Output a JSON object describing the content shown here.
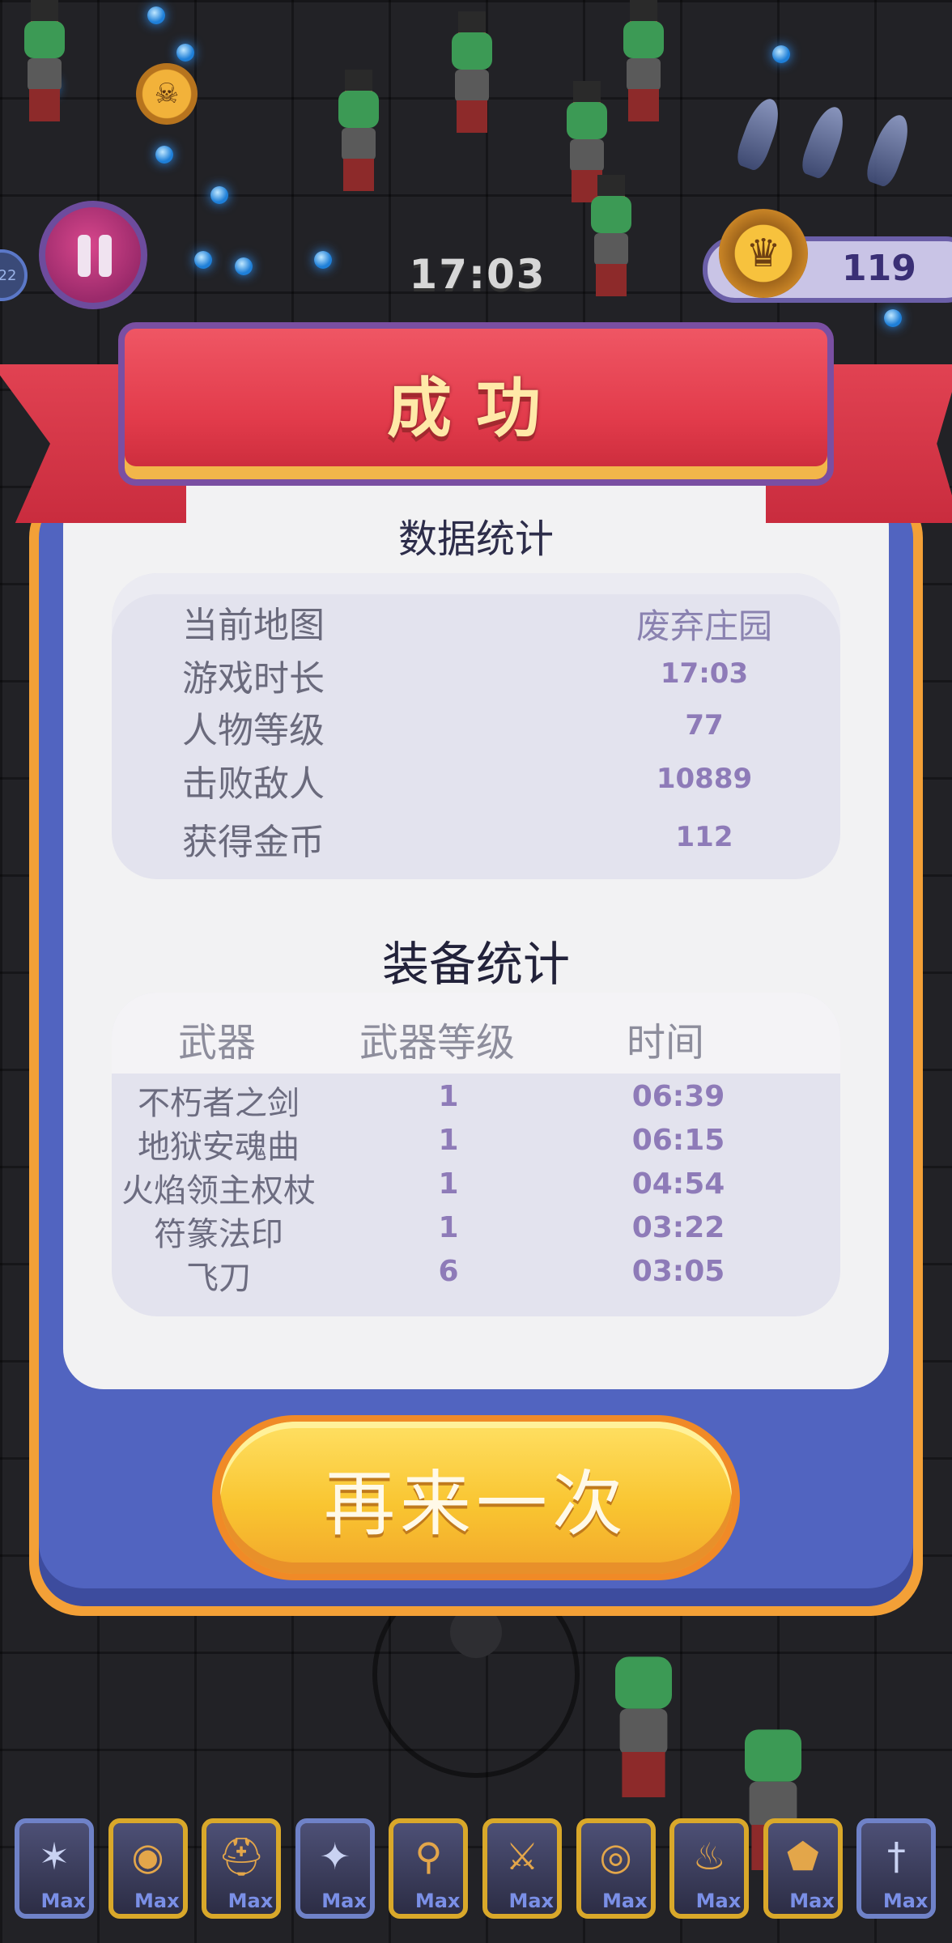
{
  "hud": {
    "timer": "17:03",
    "score": "119",
    "left_badge": "22"
  },
  "result": {
    "title": "成功",
    "stats_title": "数据统计",
    "stats": [
      {
        "label": "当前地图",
        "value": "废弃庄园"
      },
      {
        "label": "游戏时长",
        "value": "17:03"
      },
      {
        "label": "人物等级",
        "value": "77"
      },
      {
        "label": "击败敌人",
        "value": "10889"
      },
      {
        "label": "获得金币",
        "value": "112"
      }
    ],
    "equip_title": "装备统计",
    "equip_headers": [
      "武器",
      "武器等级",
      "时间"
    ],
    "equipment": [
      {
        "weapon": "不朽者之剑",
        "level": "1",
        "time": "06:39"
      },
      {
        "weapon": "地狱安魂曲",
        "level": "1",
        "time": "06:15"
      },
      {
        "weapon": "火焰领主权杖",
        "level": "1",
        "time": "04:54"
      },
      {
        "weapon": "符篆法印",
        "level": "1",
        "time": "03:22"
      },
      {
        "weapon": "飞刀",
        "level": "6",
        "time": "03:05"
      }
    ],
    "retry_label": "再来一次"
  },
  "skills": [
    {
      "icon": "wings-icon",
      "glyph": "✶",
      "label": "Max",
      "frame": "blue"
    },
    {
      "icon": "shield-icon",
      "glyph": "◉",
      "label": "Max",
      "frame": "gold"
    },
    {
      "icon": "helmet-icon",
      "glyph": "⛑",
      "label": "Max",
      "frame": "gold"
    },
    {
      "icon": "bat-wings-icon",
      "glyph": "✦",
      "label": "Max",
      "frame": "blue"
    },
    {
      "icon": "magic-staff-icon",
      "glyph": "⚲",
      "label": "Max",
      "frame": "gold"
    },
    {
      "icon": "sword-icon",
      "glyph": "⚔",
      "label": "Max",
      "frame": "gold"
    },
    {
      "icon": "target-ring-icon",
      "glyph": "◎",
      "label": "Max",
      "frame": "gold"
    },
    {
      "icon": "torch-icon",
      "glyph": "♨",
      "label": "Max",
      "frame": "gold"
    },
    {
      "icon": "armor-icon",
      "glyph": "⬟",
      "label": "Max",
      "frame": "gold"
    },
    {
      "icon": "dagger-icon",
      "glyph": "†",
      "label": "Max",
      "frame": "blue"
    }
  ]
}
